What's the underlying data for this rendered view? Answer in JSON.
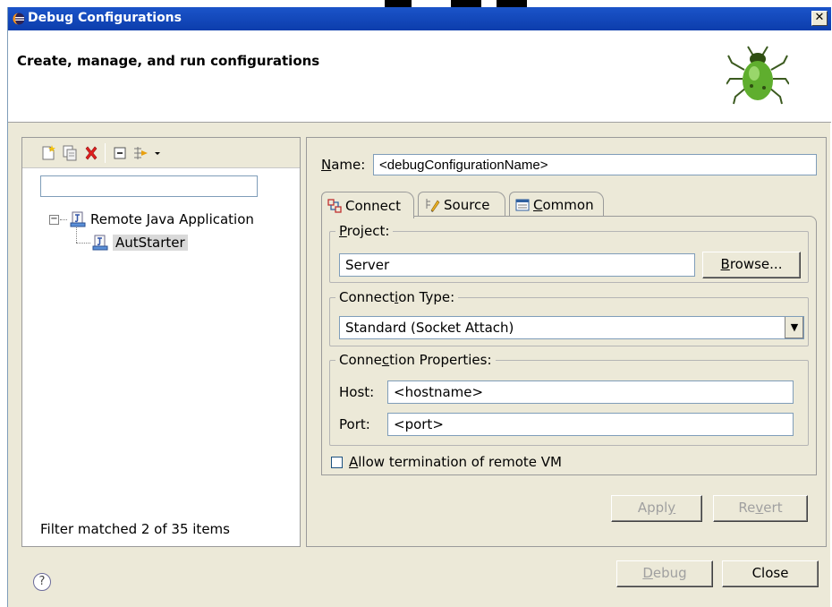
{
  "window": {
    "title": "Debug Configurations",
    "close_glyph": "✕"
  },
  "banner": {
    "heading": "Create, manage, and run configurations",
    "icon": "debug-bug-icon"
  },
  "left_panel": {
    "toolbar_icons": [
      "new-configuration-icon",
      "duplicate-icon",
      "delete-icon",
      "collapse-all-icon",
      "filter-icon",
      "dropdown-arrow-icon"
    ],
    "filter_placeholder": "",
    "tree": {
      "root": "Remote Java Application",
      "children": [
        "AutStarter"
      ]
    },
    "status": "Filter matched 2 of 35 items"
  },
  "right_panel": {
    "name_label": {
      "mnemonic": "N",
      "rest": "ame:"
    },
    "name_value": "<debugConfigurationName>",
    "tabs": [
      {
        "label": "Connect",
        "icon": "connect-icon"
      },
      {
        "label": "Source",
        "icon": "source-icon"
      },
      {
        "label_mnemonic": "C",
        "label_rest": "ommon",
        "icon": "common-icon"
      }
    ],
    "project": {
      "label_mnemonic": "P",
      "label_rest": "roject:",
      "value": "Server",
      "browse_mnemonic": "B",
      "browse_rest": "rowse..."
    },
    "connection_type": {
      "label_pre": "Connect",
      "label_mnemonic": "i",
      "label_post": "on Type:",
      "value": "Standard (Socket Attach)"
    },
    "connection_properties": {
      "label_pre": "Conne",
      "label_mnemonic": "c",
      "label_post": "tion Properties:",
      "host_label": "Host:",
      "host_value": "<hostname>",
      "port_label": "Port:",
      "port_value": "<port>"
    },
    "allow_termination": {
      "mnemonic": "A",
      "rest": "llow termination of remote VM",
      "checked": false
    },
    "apply": {
      "pre": "Appl",
      "mnemonic": "y"
    },
    "revert": {
      "pre": "Re",
      "mnemonic": "v",
      "post": "ert"
    }
  },
  "footer": {
    "help_glyph": "?",
    "debug": {
      "mnemonic": "D",
      "rest": "ebug"
    },
    "close": "Close"
  }
}
